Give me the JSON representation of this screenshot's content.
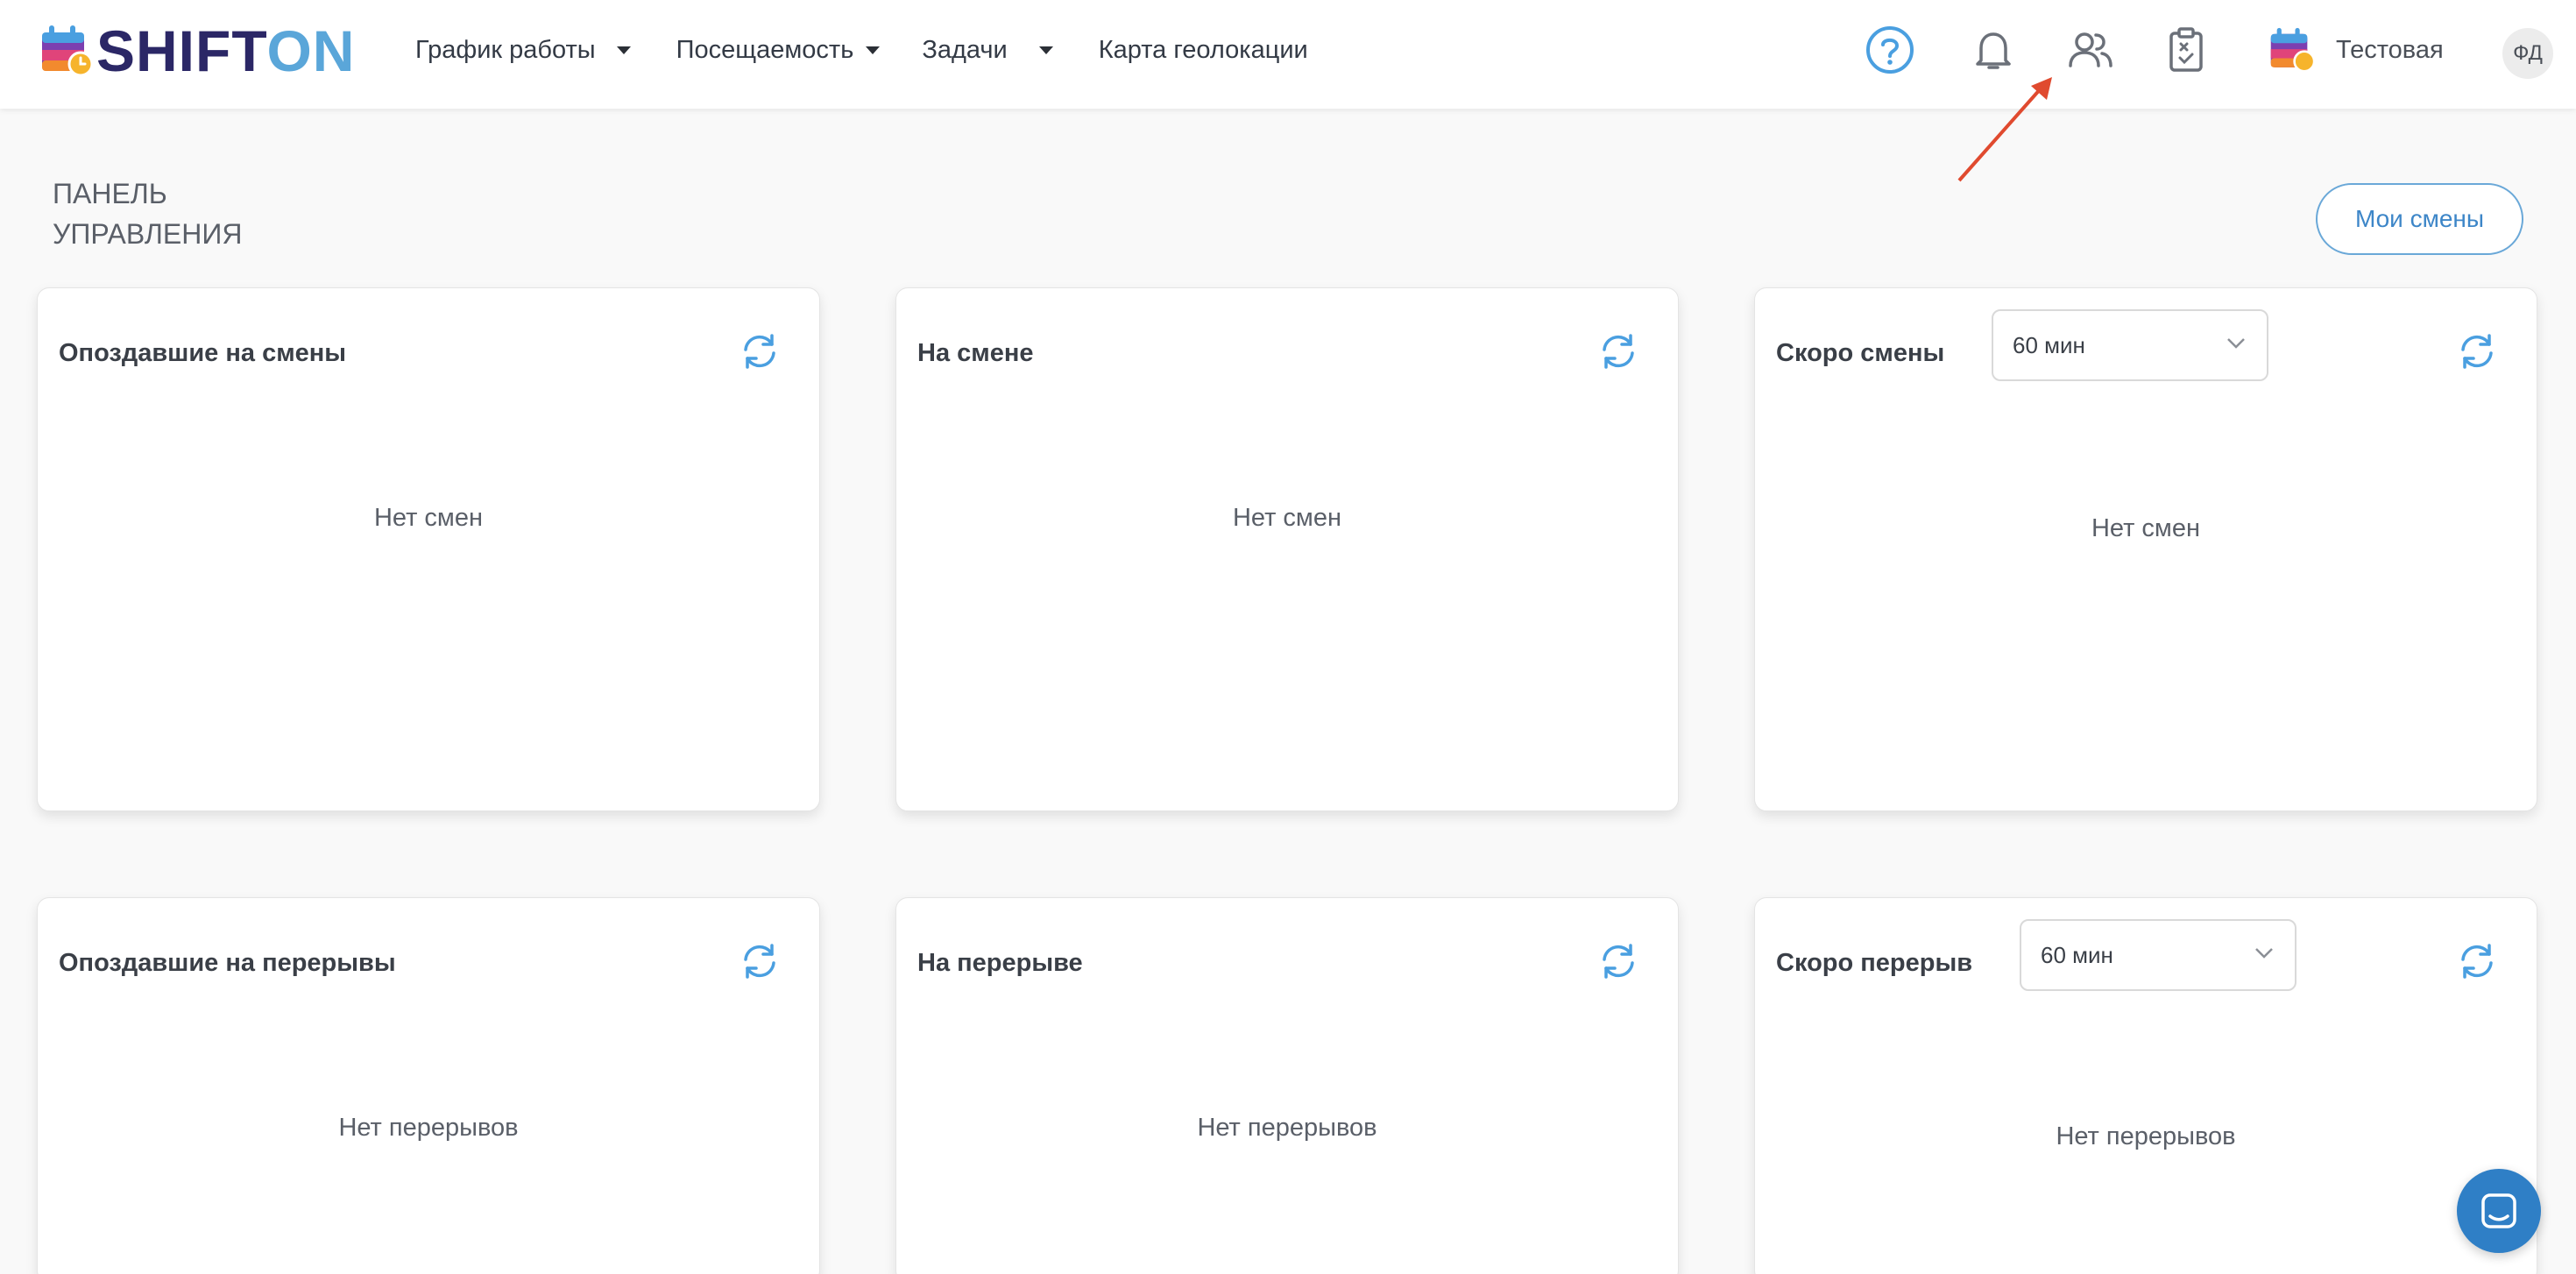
{
  "brand": {
    "logo_text_dark": "SHIFT",
    "logo_text_light": "ON",
    "dark_color": "#2b2766",
    "light_color": "#5aa6d9"
  },
  "nav": [
    {
      "label": "График работы",
      "has_dropdown": true
    },
    {
      "label": "Посещаемость",
      "has_dropdown": true
    },
    {
      "label": "Задачи",
      "has_dropdown": true
    },
    {
      "label": "Карта геолокации",
      "has_dropdown": false
    }
  ],
  "header_icons": [
    "help-icon",
    "bell-icon",
    "users-icon",
    "clipboard-icon"
  ],
  "account": {
    "label": "Тестовая",
    "avatar_initials": "ФД"
  },
  "page": {
    "title_line1": "ПАНЕЛЬ",
    "title_line2": "УПРАВЛЕНИЯ",
    "my_shifts_label": "Мои смены"
  },
  "cards": {
    "late_shifts": {
      "title": "Опоздавшие на смены",
      "empty": "Нет смен"
    },
    "on_shift": {
      "title": "На смене",
      "empty": "Нет смен"
    },
    "soon_shifts": {
      "title": "Скоро смены",
      "select_value": "60 мин",
      "empty": "Нет смен"
    },
    "late_breaks": {
      "title": "Опоздавшие на перерывы",
      "empty": "Нет перерывов"
    },
    "on_break": {
      "title": "На перерыве",
      "empty": "Нет перерывов"
    },
    "soon_breaks": {
      "title": "Скоро перерыв",
      "select_value": "60 мин",
      "empty": "Нет перерывов"
    }
  },
  "colors": {
    "accent": "#3d86c8",
    "arrow": "#e04a2f",
    "chat": "#2f7fc6"
  }
}
